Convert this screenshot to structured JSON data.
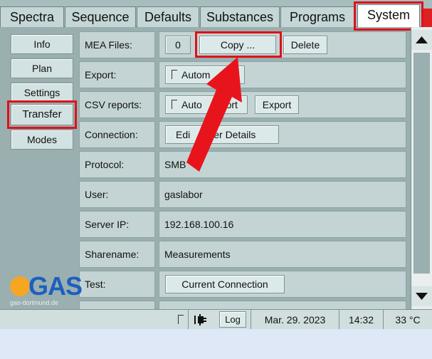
{
  "tabs": [
    {
      "label": "Spectra",
      "active": false
    },
    {
      "label": "Sequence",
      "active": false
    },
    {
      "label": "Defaults",
      "active": false
    },
    {
      "label": "Substances",
      "active": false
    },
    {
      "label": "Programs",
      "active": false
    },
    {
      "label": "System",
      "active": true
    }
  ],
  "sidebar": {
    "items": [
      {
        "label": "Info"
      },
      {
        "label": "Plan"
      },
      {
        "label": "Settings"
      },
      {
        "label": "Transfer",
        "selected": true
      },
      {
        "label": "Modes"
      }
    ]
  },
  "rows": {
    "mea": {
      "label": "MEA Files:",
      "count": "0",
      "copy": "Copy ...",
      "delete": "Delete"
    },
    "export": {
      "label": "Export:",
      "auto": "Autom"
    },
    "csv": {
      "label": "CSV reports:",
      "auto": "Auto",
      "auto_tail": "port",
      "export": "Export"
    },
    "connection": {
      "label": "Connection:",
      "edit_head": "Edi",
      "edit_tail": "ver Details"
    },
    "protocol": {
      "label": "Protocol:",
      "value": "SMB"
    },
    "user": {
      "label": "User:",
      "value": "gaslabor"
    },
    "server_ip": {
      "label": "Server IP:",
      "value": "192.168.100.16"
    },
    "sharename": {
      "label": "Sharename:",
      "value": "Measurements"
    },
    "test": {
      "label": "Test:",
      "button": "Current Connection"
    }
  },
  "status": {
    "log": "Log",
    "date": "Mar. 29. 2023",
    "time": "14:32",
    "temp": "33 °C"
  },
  "logo": {
    "text": "GAS",
    "sub": "gas-dortmund.de"
  },
  "colors": {
    "highlight": "#e0101a",
    "arrow": "#e8141c",
    "panel": "#9aafaf"
  }
}
